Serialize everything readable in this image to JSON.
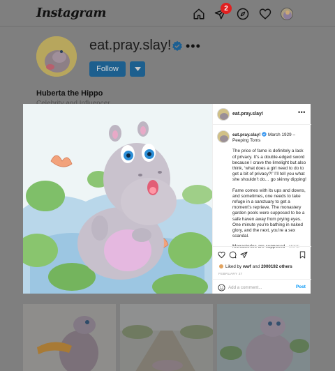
{
  "app": {
    "logo": "Instagram"
  },
  "nav": {
    "notifications_count": "2"
  },
  "profile": {
    "username": "eat.pray.slay!",
    "more": "•••",
    "follow_label": "Follow",
    "display_name": "Huberta the Hippo",
    "category": "Celebrity and Influencer"
  },
  "post": {
    "username": "eat.pray.slay!",
    "header_more": "•••",
    "caption_title": " March 1929 – Peeping Toms",
    "caption_p1": "The price of fame is definitely a lack of privacy. It’s a double-edged sword because I crave the limelight but also think, ‘what does a girl need to do to get a bit of privacy?!’ I’ll tell you what she shouldn’t do… go skinny dipping!",
    "caption_p2": "Fame comes with its ups and downs, and sometimes, one needs to take refuge in a sanctuary to get a moment’s reprieve. The monastery garden pools were supposed to be a safe haven away from prying eyes. One minute you’re bathing in naked glory, and the next, you’re a sex scandal.",
    "caption_p3": "Monasteries are supposed",
    "more_label": "more",
    "liked_prefix": "Liked by ",
    "liked_user": "wwf",
    "liked_mid": " and ",
    "liked_count": "2000192 others",
    "date": "FEBRUARY 27",
    "comment_placeholder": "Add a comment...",
    "post_label": "Post"
  },
  "colors": {
    "accent": "#0095f6",
    "verified": "#3897f0",
    "badge": "#ed4956"
  },
  "icons": [
    "home-icon",
    "direct-icon",
    "explore-icon",
    "heart-icon",
    "verified-icon",
    "chevron-down-icon",
    "comment-icon",
    "share-icon",
    "bookmark-icon",
    "emoji-icon"
  ]
}
